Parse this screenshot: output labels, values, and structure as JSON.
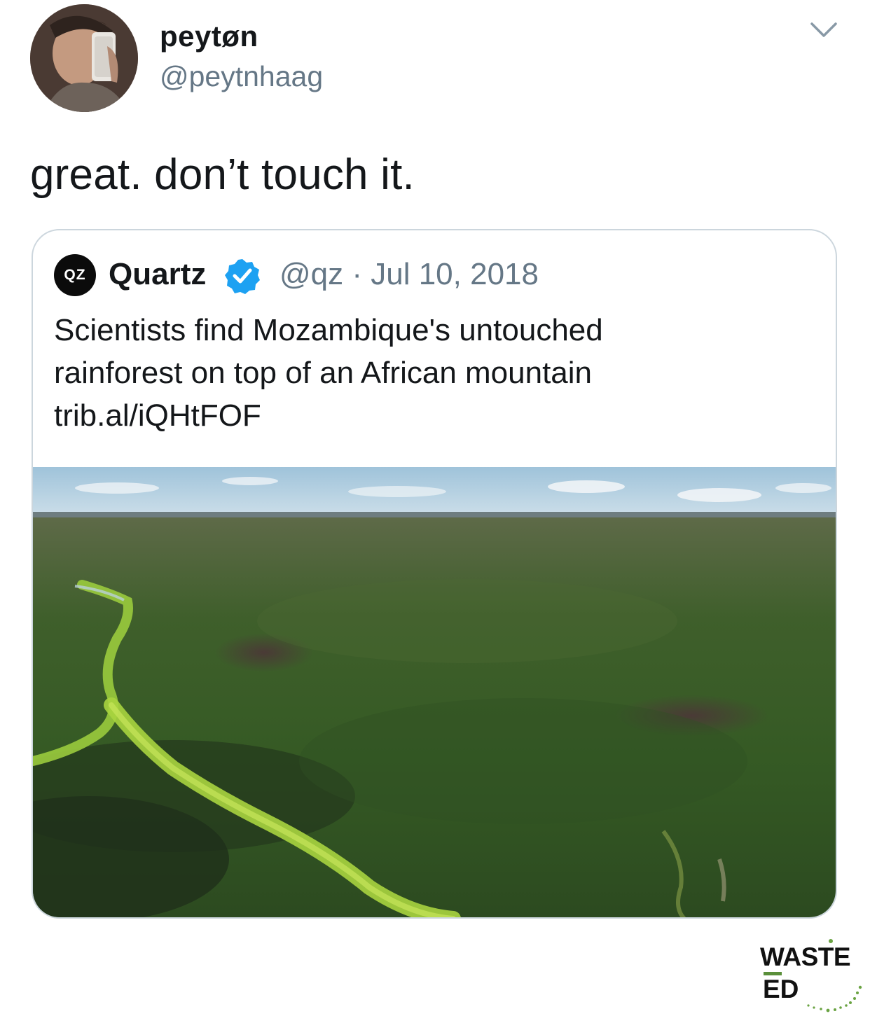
{
  "author": {
    "display_name": "peytøn",
    "handle": "@peytnhaag",
    "avatar_icon": "user-avatar"
  },
  "header": {
    "menu_icon": "chevron-down-icon"
  },
  "tweet": {
    "text": "great.  don’t touch it."
  },
  "quoted_tweet": {
    "logo_text": "QZ",
    "name": "Quartz",
    "verified_icon": "verified-badge-icon",
    "meta": "@qz · Jul 10, 2018",
    "lines": [
      "Scientists find Mozambique's untouched",
      "rainforest on top of an African mountain",
      "trib.al/iQHtFOF"
    ],
    "image_icon": "aerial-landscape-photo"
  },
  "watermark": {
    "line1": "WASTE",
    "line2": "ED"
  },
  "colors": {
    "text_primary": "#14171a",
    "text_secondary": "#657786",
    "border": "#ccd6dd",
    "verified_blue": "#1da1f2",
    "watermark_green": "#5a8f3a"
  }
}
